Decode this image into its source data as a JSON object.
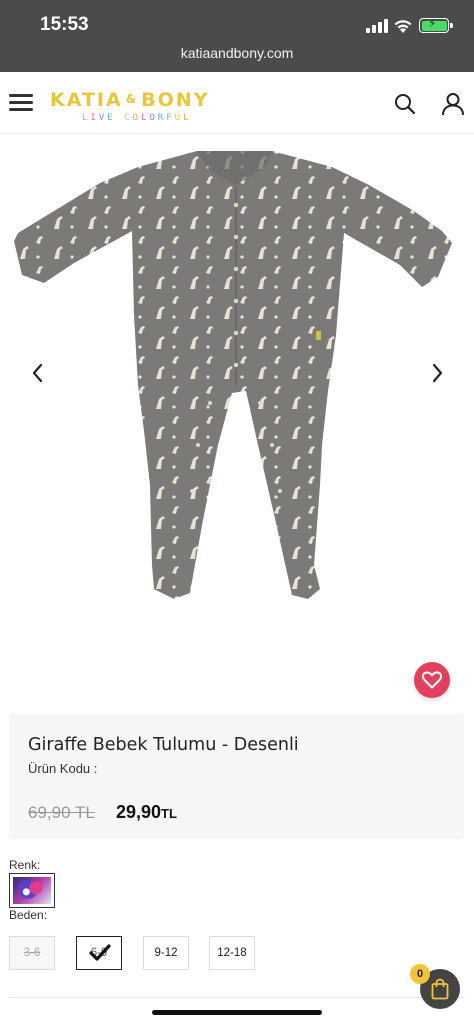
{
  "status_bar": {
    "time": "15:53",
    "url": "katiaandbony.com"
  },
  "header": {
    "brand_left": "KATIA",
    "brand_amp": "&",
    "brand_right": "BONY",
    "tagline": "LIVE COLORFUL",
    "icons": [
      "menu-icon",
      "search-icon",
      "user-icon"
    ]
  },
  "product": {
    "title": "Giraffe Bebek Tulumu - Desenli",
    "code_label": "Ürün Kodu :",
    "old_price": "69,90 TL",
    "new_price_value": "29,90",
    "new_price_currency": "TL"
  },
  "options": {
    "color_label": "Renk:",
    "size_label": "Beden:",
    "sizes": [
      {
        "label": "3-6",
        "state": "disabled"
      },
      {
        "label": "6-9",
        "state": "selected"
      },
      {
        "label": "9-12",
        "state": "available"
      },
      {
        "label": "12-18",
        "state": "available"
      }
    ]
  },
  "cart": {
    "count": "0"
  },
  "colors": {
    "brand_yellow": "#e9c53c",
    "favorite": "#e0425d",
    "status_bar": "#4b4b4b",
    "cart_badge": "#f2c43b"
  }
}
